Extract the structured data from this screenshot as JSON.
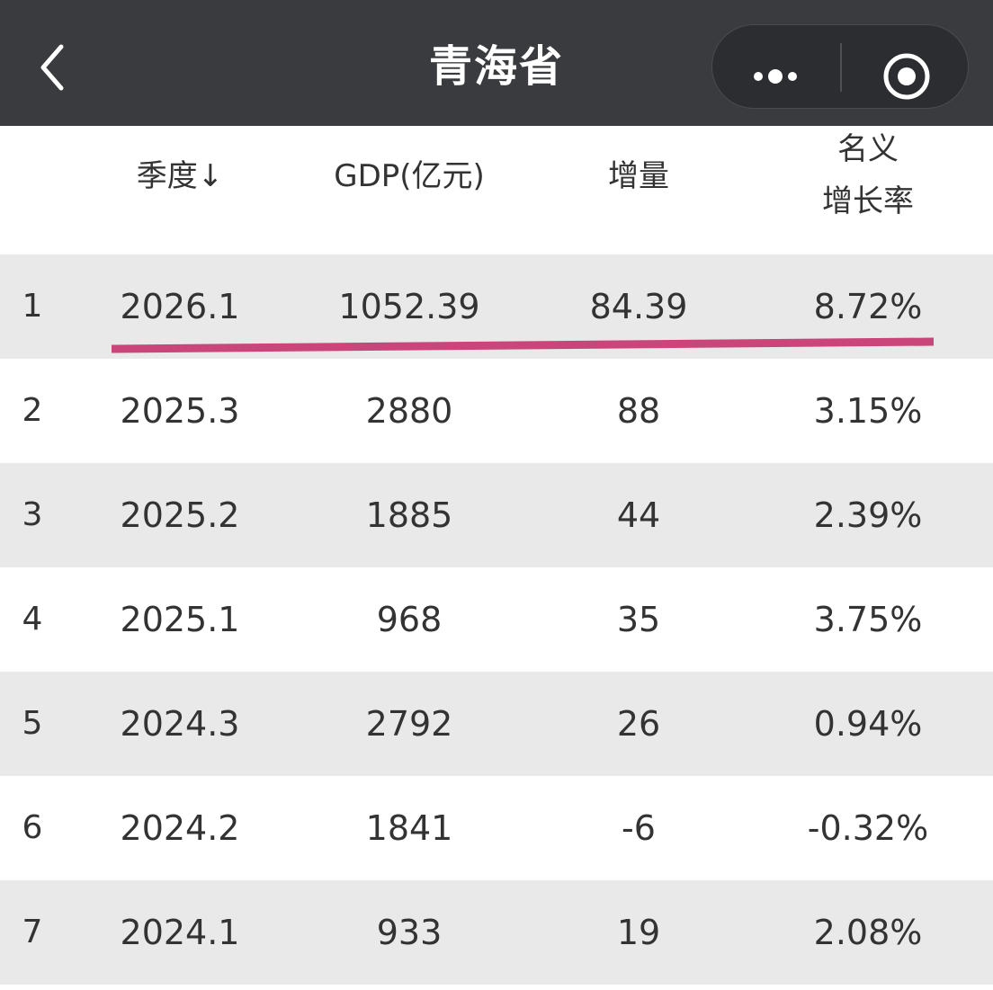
{
  "nav": {
    "title": "青海省",
    "back_icon": "chevron-left-icon",
    "more_icon": "more-dots-icon",
    "close_icon": "target-circle-icon"
  },
  "table": {
    "headers": {
      "quarter": "季度↓",
      "gdp": "GDP(亿元)",
      "increase": "增量",
      "rate_line1": "名义",
      "rate_line2": "增长率"
    },
    "rows": [
      {
        "rank": "1",
        "quarter": "2026.1",
        "gdp": "1052.39",
        "increase": "84.39",
        "rate": "8.72%"
      },
      {
        "rank": "2",
        "quarter": "2025.3",
        "gdp": "2880",
        "increase": "88",
        "rate": "3.15%"
      },
      {
        "rank": "3",
        "quarter": "2025.2",
        "gdp": "1885",
        "increase": "44",
        "rate": "2.39%"
      },
      {
        "rank": "4",
        "quarter": "2025.1",
        "gdp": "968",
        "increase": "35",
        "rate": "3.75%"
      },
      {
        "rank": "5",
        "quarter": "2024.3",
        "gdp": "2792",
        "increase": "26",
        "rate": "0.94%"
      },
      {
        "rank": "6",
        "quarter": "2024.2",
        "gdp": "1841",
        "increase": "-6",
        "rate": "-0.32%"
      },
      {
        "rank": "7",
        "quarter": "2024.1",
        "gdp": "933",
        "increase": "19",
        "rate": "2.08%"
      }
    ]
  },
  "colors": {
    "navbar_bg": "#3a3b3f",
    "row_alt_bg": "#e9e9e9",
    "highlight_underline": "#c9457a"
  }
}
